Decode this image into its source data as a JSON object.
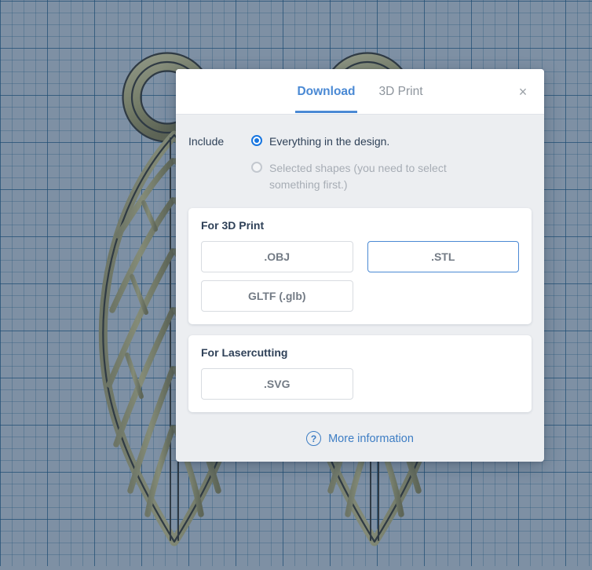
{
  "window": {
    "background": "#7e90a4",
    "grid_line_color": "#14416 9"
  },
  "dialog": {
    "tabs": [
      {
        "label": "Download",
        "active": true
      },
      {
        "label": "3D Print",
        "active": false
      }
    ],
    "close_label": "×",
    "include": {
      "label": "Include",
      "options": [
        {
          "label": "Everything in the design.",
          "selected": true,
          "disabled": false
        },
        {
          "label": "Selected shapes (you need to select something first.)",
          "selected": false,
          "disabled": true
        }
      ]
    },
    "sections": [
      {
        "title": "For 3D Print",
        "buttons": [
          {
            "label": ".OBJ",
            "highlighted": false
          },
          {
            "label": ".STL",
            "highlighted": true
          },
          {
            "label": "GLTF (.glb)",
            "highlighted": false
          }
        ]
      },
      {
        "title": "For Lasercutting",
        "buttons": [
          {
            "label": ".SVG",
            "highlighted": false
          }
        ]
      }
    ],
    "footer": {
      "help_icon": "?",
      "link_label": "More information"
    },
    "accent_color": "#4a89d4",
    "radio_color": "#1775e0"
  }
}
